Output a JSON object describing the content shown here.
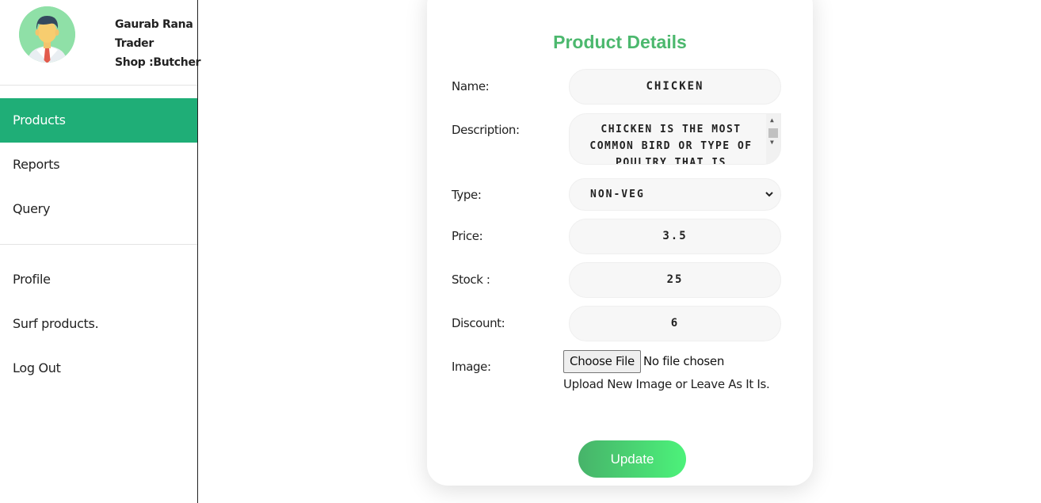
{
  "profile": {
    "name": "Gaurab Rana",
    "role": "Trader",
    "shop": "Shop :Butcher"
  },
  "nav": {
    "primary": [
      {
        "label": "Products",
        "active": true
      },
      {
        "label": "Reports",
        "active": false
      },
      {
        "label": "Query",
        "active": false
      }
    ],
    "secondary": [
      {
        "label": "Profile"
      },
      {
        "label": "Surf products."
      },
      {
        "label": "Log Out"
      }
    ]
  },
  "form": {
    "title": "Product Details",
    "labels": {
      "name": "Name:",
      "description": "Description:",
      "type": "Type:",
      "price": "Price:",
      "stock": "Stock :",
      "discount": "Discount:",
      "image": "Image:"
    },
    "values": {
      "name": "CHICKEN",
      "description": "CHICKEN IS THE MOST COMMON BIRD OR TYPE OF POULTRY THAT IS",
      "type": "NON-VEG",
      "price": "3.5",
      "stock": "25",
      "discount": "6"
    },
    "file": {
      "button_label": "Choose File",
      "status": "No file chosen",
      "hint": "Upload New Image or Leave As It Is."
    },
    "submit_label": "Update"
  },
  "colors": {
    "accent": "#1fae77",
    "title": "#4cb86e",
    "button_gradient_start": "#47b36a",
    "button_gradient_end": "#4cf27a"
  }
}
